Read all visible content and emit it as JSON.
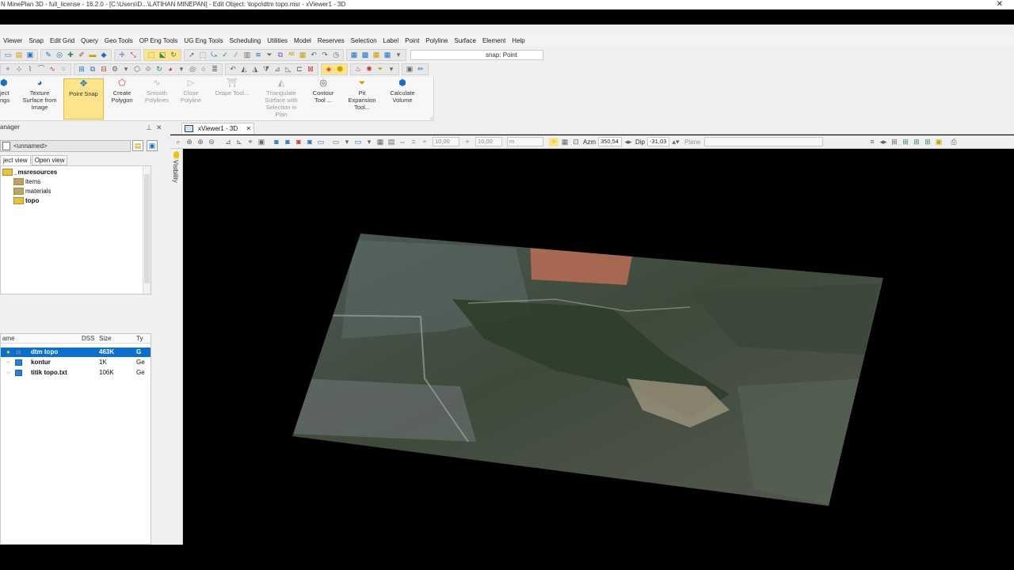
{
  "window": {
    "title": "N MinePlan 3D - full_license - 16.2.0 - [C:\\Users\\D...\\LATIHAN MINEPAN] - Edit Object: \\topo\\dtm topo.msr - xViewer1 - 3D",
    "close_glyph": "✕"
  },
  "menu": [
    "Viewer",
    "Snap",
    "Edit Grid",
    "Query",
    "Geo Tools",
    "OP Eng Tools",
    "UG Eng Tools",
    "Scheduling",
    "Utilities",
    "Model",
    "Reserves",
    "Selection",
    "Label",
    "Point",
    "Polyline",
    "Surface",
    "Element",
    "Help"
  ],
  "toolbar": {
    "snap_field": "snap: Point"
  },
  "ribbon": {
    "items": [
      {
        "label": "Object Settings",
        "text": "ject\nngs",
        "icon": "object-settings-icon",
        "state": "normal"
      },
      {
        "label": "Texture Surface from Image",
        "text": "Texture\nSurface from\nImage",
        "icon": "texture-icon",
        "state": "normal"
      },
      {
        "label": "Point Snap",
        "text": "Point Snap",
        "icon": "point-snap-icon",
        "state": "active"
      },
      {
        "label": "Create Polygon",
        "text": "Create\nPolygon",
        "icon": "polygon-icon",
        "state": "normal"
      },
      {
        "label": "Smooth Polylines",
        "text": "Smooth\nPolylines",
        "icon": "smooth-icon",
        "state": "disabled"
      },
      {
        "label": "Close Polyline",
        "text": "Close\nPolyline",
        "icon": "close-polyline-icon",
        "state": "disabled"
      },
      {
        "label": "Drape Tool...",
        "text": "Drape Tool...",
        "icon": "drape-icon",
        "state": "disabled"
      },
      {
        "label": "Triangulate Surface with Selection in Plan",
        "text": "Triangulate\nSurface with\nSelection in\nPlan",
        "icon": "triangulate-icon",
        "state": "disabled"
      },
      {
        "label": "Contour Tool ...",
        "text": "Contour\nTool ...",
        "icon": "contour-icon",
        "state": "normal"
      },
      {
        "label": "Pit Expansion Tool...",
        "text": "Pit\nExpansion\nTool...",
        "icon": "pit-icon",
        "state": "normal"
      },
      {
        "label": "Calculate Volume",
        "text": "Calculate\nVolume",
        "icon": "volume-icon",
        "state": "normal"
      }
    ]
  },
  "data_manager": {
    "title": "anager",
    "pin_glyph": "⊥",
    "close_glyph": "✕",
    "combo_value": "<unnamed>",
    "tabs": [
      "ject view",
      "Open view"
    ],
    "tree": [
      {
        "label": "_msresources",
        "indent": 0,
        "bold": true
      },
      {
        "label": "items",
        "indent": 1,
        "bold": false
      },
      {
        "label": "materials",
        "indent": 1,
        "bold": false
      },
      {
        "label": "topo",
        "indent": 1,
        "bold": true
      }
    ],
    "list_headers": {
      "name": "ame",
      "dss": "DSS",
      "size": "Size",
      "type": "Ty"
    },
    "files": [
      {
        "name": "dtm topo",
        "size": "463K",
        "type": "G",
        "selected": true
      },
      {
        "name": "kontur",
        "size": "1K",
        "type": "Ge",
        "selected": false
      },
      {
        "name": "titik topo.txt",
        "size": "106K",
        "type": "Ge",
        "selected": false
      }
    ]
  },
  "viewer": {
    "tab_label": "xViewer1 - 3D",
    "tab_close": "✕",
    "step1": "10,00",
    "step2": "10,00",
    "unit": "m",
    "azm_label": "Azm",
    "azm_value": "350,54",
    "dip_label": "Dip",
    "dip_value": "-31,03",
    "plane_label": "Plane",
    "visibility_label": "Visibility"
  },
  "colors": {
    "accent": "#0a6fcf",
    "active_ribbon": "#fde38a",
    "canvas": "#000000"
  }
}
